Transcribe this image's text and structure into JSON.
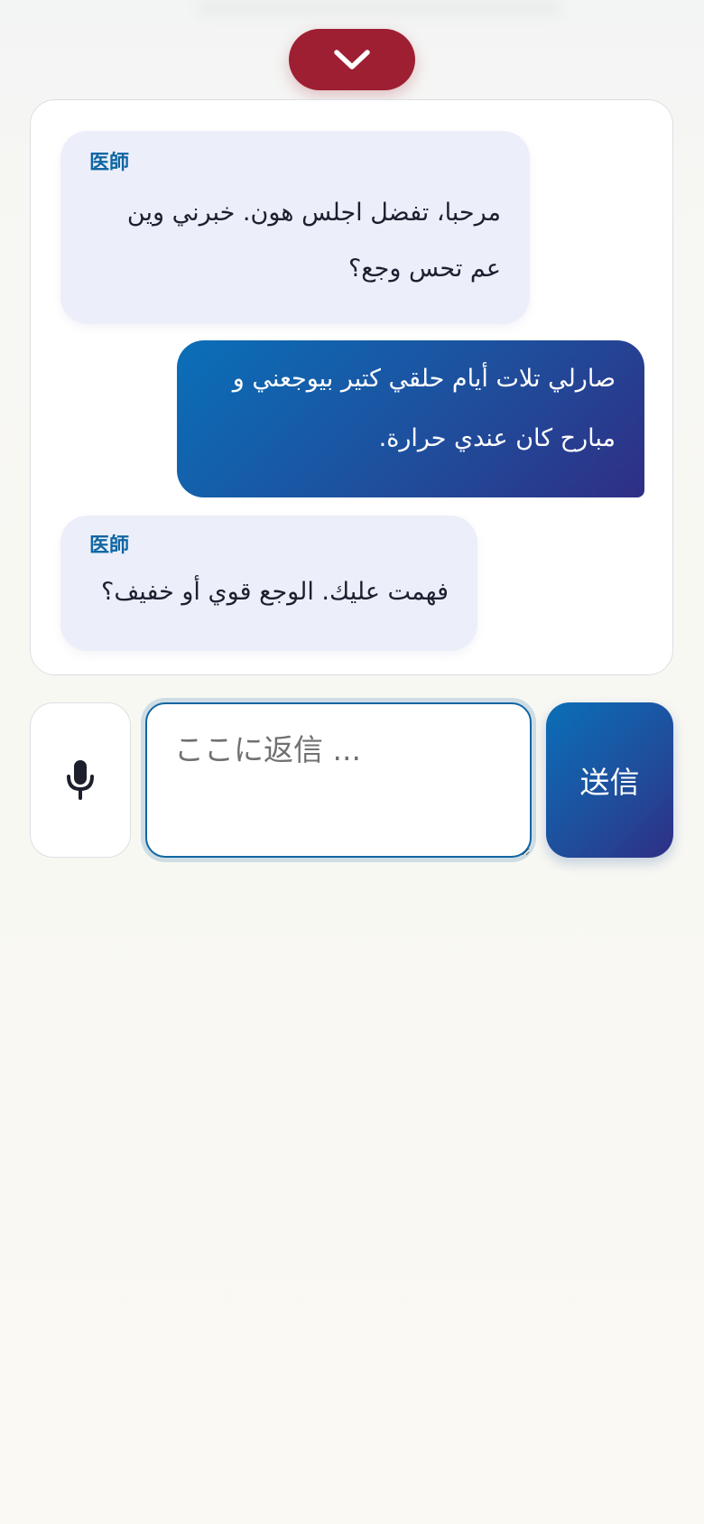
{
  "header": {
    "collapse_icon": "chevron-down-icon"
  },
  "chat": {
    "messages": [
      {
        "role": "doctor",
        "speaker": "医師",
        "text": "مرحبا، تفضل اجلس هون. خبرني وين عم تحس وجع؟"
      },
      {
        "role": "patient",
        "speaker": "",
        "text": "صارلي تلات أيام حلقي كتير بيوجعني و مبارح كان عندي حرارة."
      },
      {
        "role": "doctor",
        "speaker": "医師",
        "text": "فهمت عليك. الوجع قوي أو خفيف؟"
      }
    ]
  },
  "composer": {
    "mic_icon": "microphone-icon",
    "placeholder": "ここに返信 ...",
    "value": "",
    "send_label": "送信"
  },
  "colors": {
    "accent_red": "#9e1f32",
    "accent_blue": "#0f66a3",
    "doctor_bubble": "#eceff9",
    "patient_gradient_start": "#0a6fb8",
    "patient_gradient_end": "#2f2f85"
  }
}
